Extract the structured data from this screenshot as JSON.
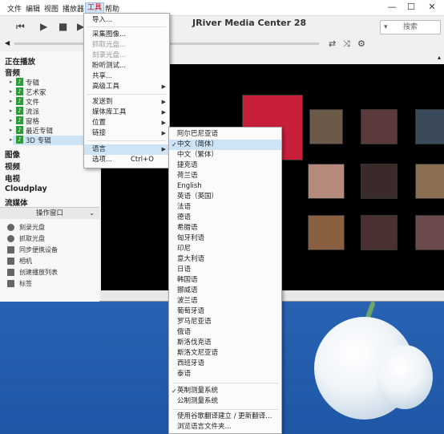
{
  "menubar": {
    "items": [
      "文件",
      "编辑",
      "视图",
      "播放器",
      "工具",
      "帮助"
    ]
  },
  "title": "JRiver Media Center 28",
  "search": {
    "placeholder": "搜索"
  },
  "sidebar": {
    "now_playing": "正在播放",
    "audio": "音频",
    "audio_items": [
      "专辑",
      "艺术家",
      "文件",
      "流派",
      "窗格",
      "最近专辑",
      "3D 专辑"
    ],
    "images": "图像",
    "video": "视频",
    "tv": "电视",
    "cloudplay": "Cloudplay",
    "streaming": "流媒体"
  },
  "op_window": {
    "title": "操作窗口",
    "items": [
      "刻录光盘",
      "抓取光盘",
      "同步便携设备",
      "相机",
      "创建播放列表",
      "标签"
    ]
  },
  "tools_menu": {
    "items": [
      {
        "label": "导入..."
      },
      {
        "label": "采集图像..."
      },
      {
        "label": "抓取光盘...",
        "disabled": true
      },
      {
        "label": "刻录光盘...",
        "disabled": true
      },
      {
        "label": "盼听测试..."
      },
      {
        "label": "共享..."
      },
      {
        "label": "高级工具"
      },
      {
        "label": "发送到"
      },
      {
        "label": "媒体库工具"
      },
      {
        "label": "位置"
      },
      {
        "label": "链接"
      },
      {
        "label": "语言"
      },
      {
        "label": "选项...",
        "shortcut": "Ctrl+O"
      }
    ]
  },
  "lang_menu": {
    "items": [
      "阿尔巴尼亚语",
      "中文（简体）",
      "中文（繁体）",
      "捷克语",
      "荷兰语",
      "English",
      "英语（英国）",
      "法语",
      "德语",
      "希腊语",
      "匈牙利语",
      "印尼",
      "意大利语",
      "日语",
      "韩国语",
      "挪威语",
      "波兰语",
      "葡萄牙语",
      "罗马尼亚语",
      "俄语",
      "斯洛伐克语",
      "斯洛文尼亚语",
      "西班牙语",
      "泰语"
    ],
    "units": [
      "英制测量系统",
      "公制测量系统"
    ],
    "footer": [
      "使用谷歌翻译建立 / 更新翻译...",
      "浏览语言文件夹..."
    ]
  }
}
